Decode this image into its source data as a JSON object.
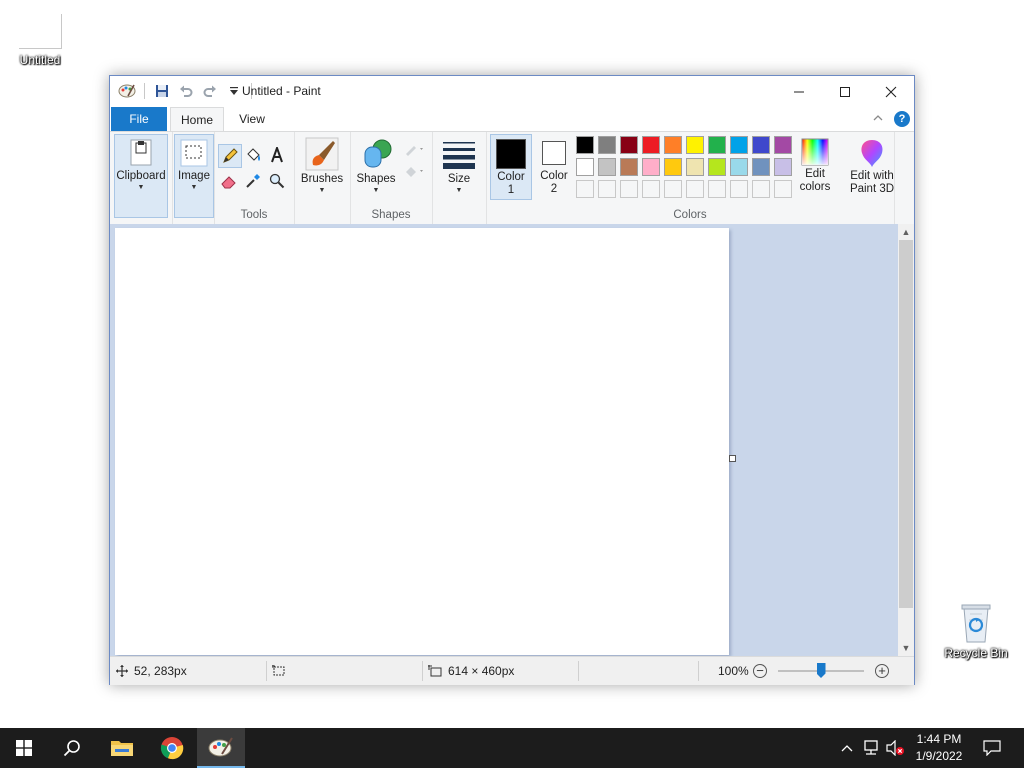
{
  "desktop": {
    "icons": [
      {
        "label": "Untitled"
      },
      {
        "label": "Recycle Bin"
      }
    ]
  },
  "window": {
    "title": "Untitled - Paint",
    "tabs": {
      "file": "File",
      "home": "Home",
      "view": "View"
    },
    "ribbon": {
      "clipboard": "Clipboard",
      "image": "Image",
      "tools_group": "Tools",
      "brushes": "Brushes",
      "shapes": "Shapes",
      "shapes_group": "Shapes",
      "size": "Size",
      "color1_line1": "Color",
      "color1_line2": "1",
      "color2_line1": "Color",
      "color2_line2": "2",
      "colors_group": "Colors",
      "edit_colors_line1": "Edit",
      "edit_colors_line2": "colors",
      "paint3d_line1": "Edit with",
      "paint3d_line2": "Paint 3D"
    },
    "colors": {
      "color1": "#000000",
      "color2": "#ffffff",
      "palette_row1": [
        "#000000",
        "#7f7f7f",
        "#880015",
        "#ed1c24",
        "#ff7f27",
        "#fff200",
        "#22b14c",
        "#00a2e8",
        "#3f48cc",
        "#a349a4"
      ],
      "palette_row2": [
        "#ffffff",
        "#c3c3c3",
        "#b97a57",
        "#ffaec9",
        "#ffc90e",
        "#efe4b0",
        "#b5e61d",
        "#99d9ea",
        "#7092be",
        "#c8bfe7"
      ],
      "palette_row3": [
        "#f5f6f7",
        "#f5f6f7",
        "#f5f6f7",
        "#f5f6f7",
        "#f5f6f7",
        "#f5f6f7",
        "#f5f6f7",
        "#f5f6f7",
        "#f5f6f7",
        "#f5f6f7"
      ]
    },
    "status": {
      "cursor_pos": "52, 283px",
      "selection_size": "",
      "image_size": "614 × 460px",
      "zoom": "100%",
      "zoom_fraction": 0.5
    }
  },
  "taskbar": {
    "time": "1:44 PM",
    "date": "1/9/2022"
  }
}
